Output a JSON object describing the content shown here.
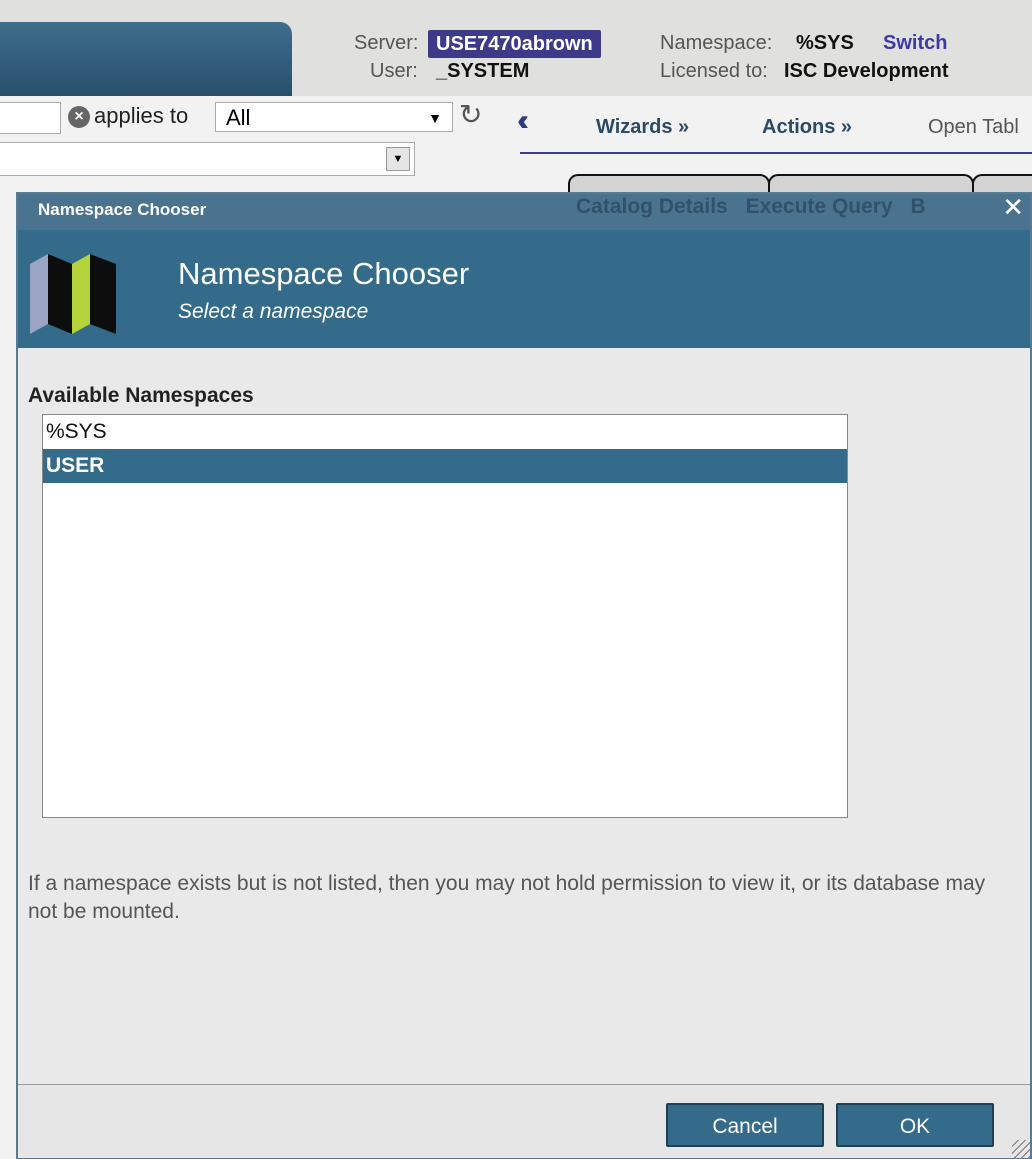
{
  "header": {
    "server_label": "Server:",
    "server_value": "USE7470abrown",
    "user_label": "User:",
    "user_value": "_SYSTEM",
    "namespace_label": "Namespace:",
    "namespace_value": "%SYS",
    "switch_label": "Switch",
    "licensed_label": "Licensed to:",
    "licensed_value": "ISC Development",
    "colors": {
      "server_badge": "#3e3a8a",
      "header_tab": "#274f6b"
    }
  },
  "toolbar": {
    "applies_to_label": "applies to",
    "applies_to_value": "All",
    "second_select_value": ""
  },
  "menu": {
    "items": [
      "Wizards »",
      "Actions »",
      "Open Tabl"
    ]
  },
  "background_tabs": [
    "Catalog Details",
    "Execute Query",
    "B"
  ],
  "dialog": {
    "title": "Namespace Chooser",
    "banner_title": "Namespace Chooser",
    "banner_subtitle": "Select a namespace",
    "list_heading": "Available Namespaces",
    "namespaces": [
      "%SYS",
      "USER"
    ],
    "selected_namespace": "USER",
    "help_text": "If a namespace exists but is not listed, then you may not hold permission to view it, or its database may not be mounted.",
    "cancel_label": "Cancel",
    "ok_label": "OK",
    "colors": {
      "accent": "#356b8a"
    }
  },
  "icons": [
    "clear-icon",
    "refresh-icon",
    "collapse-icon",
    "close-icon",
    "logo",
    "resize-grip-icon"
  ]
}
